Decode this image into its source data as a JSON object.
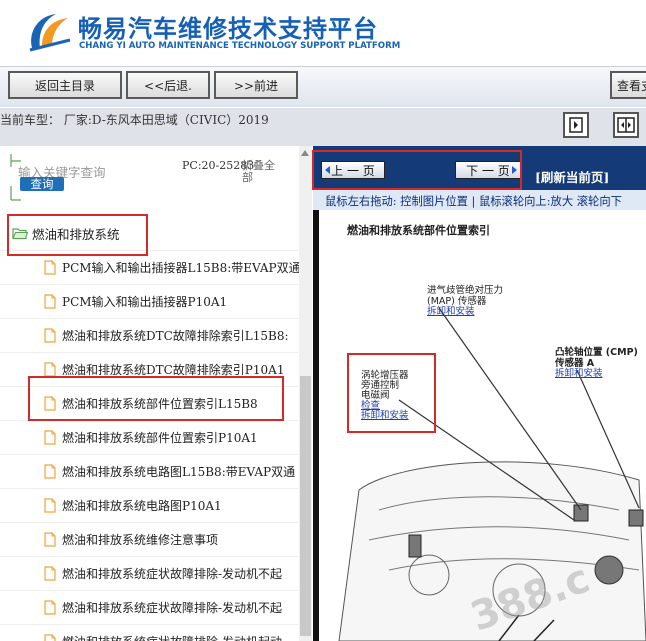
{
  "header": {
    "title": "畅易汽车维修技术支持平台",
    "subtitle": "CHANG YI AUTO MAINTENANCE TECHNOLOGY SUPPORT PLATFORM"
  },
  "toolbar": {
    "home_label": "返回主目录",
    "back_label": "<<后退.",
    "forward_label": ">>前进",
    "view_label": "查看支"
  },
  "vehicle": {
    "text": "当前车型： 厂家:D-东风本田思域（CIVIC）2019"
  },
  "left": {
    "search_placeholder": "输入关键字查询",
    "search_button": "查询",
    "pc_code": "PC:20-25283",
    "collapse_all": "折叠全部",
    "category": "燃油和排放系统",
    "items": [
      {
        "label": "PCM输入和输出插接器L15B8:带EVAP双通"
      },
      {
        "label": "PCM输入和输出插接器P10A1"
      },
      {
        "label": "燃油和排放系统DTC故障排除索引L15B8:"
      },
      {
        "label": "燃油和排放系统DTC故障排除索引P10A1"
      },
      {
        "label": "燃油和排放系统部件位置索引L15B8"
      },
      {
        "label": "燃油和排放系统部件位置索引P10A1"
      },
      {
        "label": "燃油和排放系统电路图L15B8:带EVAP双通"
      },
      {
        "label": "燃油和排放系统电路图P10A1"
      },
      {
        "label": "燃油和排放系统维修注意事项"
      },
      {
        "label": "燃油和排放系统症状故障排除-发动机不起"
      },
      {
        "label": "燃油和排放系统症状故障排除-发动机不起"
      },
      {
        "label": "燃油和排放系统症状故障排除-发动机起动"
      }
    ]
  },
  "right": {
    "prev_page": "上 一 页",
    "next_page": "下 一 页",
    "refresh": "[刷新当前页]",
    "hint": "鼠标左右拖动: 控制图片位置 | 鼠标滚轮向上:放大  滚轮向下",
    "diagram": {
      "title": "燃油和排放系统部件位置索引",
      "map_label_1": "进气歧管绝对压力",
      "map_label_2": "(MAP) 传感器",
      "map_link": "拆卸和安装",
      "cmp_label_1": "凸轮轴位置 (CMP)",
      "cmp_label_2": "传感器 A",
      "cmp_link": "拆卸和安装",
      "left_label_1": "涡轮增压器",
      "left_label_2": "旁通控制",
      "left_label_3": "电磁阀",
      "left_link_1": "检查",
      "left_link_2": "拆卸和安装",
      "watermark": "388.c"
    }
  },
  "colors": {
    "brand_blue": "#1560b5",
    "nav_dark_blue": "#153a78",
    "highlight_red": "#d42a2a"
  }
}
